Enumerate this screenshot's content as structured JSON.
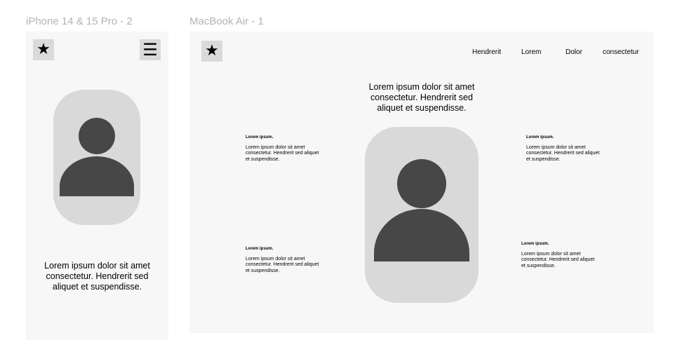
{
  "frames": {
    "mobile": {
      "label": "iPhone 14 & 15 Pro - 2"
    },
    "desktop": {
      "label": "MacBook Air - 1"
    }
  },
  "icons": {
    "logo": "star-icon",
    "menu": "hamburger-menu-icon",
    "avatar": "user-silhouette-icon"
  },
  "colors": {
    "frame_bg": "#f7f7f7",
    "icon_bg": "#dadada",
    "card_bg": "#d9d9d9",
    "avatar": "#474747"
  },
  "mobile": {
    "description": "Lorem ipsum dolor sit amet consectetur. Hendrerit sed aliquet et suspendisse."
  },
  "desktop": {
    "nav": [
      "Hendrerit",
      "Lorem",
      "Dolor",
      "consectetur"
    ],
    "headline": "Lorem ipsum dolor sit amet consectetur. Hendrerit sed aliquet et suspendisse.",
    "features": [
      {
        "title": "Lorem ipsum.",
        "body": "Lorem ipsum dolor sit amet consectetur. Hendrerit sed aliquet et suspendisse."
      },
      {
        "title": "Lorem ipsum.",
        "body": "Lorem ipsum dolor sit amet consectetur. Hendrerit sed aliquet et suspendisse."
      },
      {
        "title": "Lorem ipsum.",
        "body": "Lorem ipsum dolor sit amet consectetur. Hendrerit sed aliquet et suspendisse."
      },
      {
        "title": "Lorem ipsum.",
        "body": "Lorem ipsum dolor sit amet consectetur. Hendrerit sed aliquet et suspendisse."
      }
    ]
  }
}
